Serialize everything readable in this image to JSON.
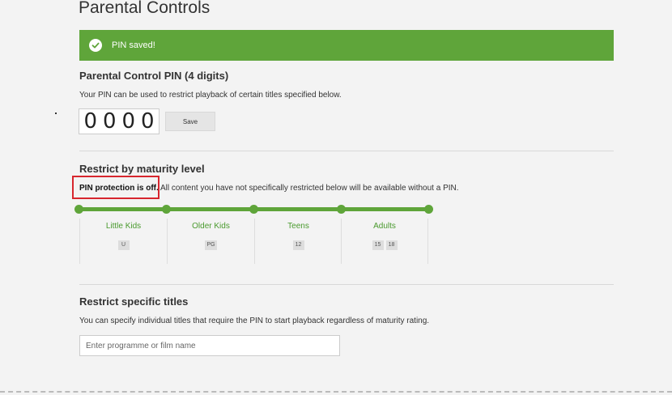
{
  "page": {
    "title": "Parental Controls"
  },
  "banner": {
    "message": "PIN saved!",
    "color": "#5fa53a"
  },
  "pin": {
    "heading": "Parental Control PIN (4 digits)",
    "description": "Your PIN can be used to restrict playback of certain titles specified below.",
    "digits": [
      "0",
      "0",
      "0",
      "0"
    ],
    "save_label": "Save"
  },
  "maturity": {
    "heading": "Restrict by maturity level",
    "status_bold": "PIN protection is off.",
    "status_rest": " All content you have not specifically restricted below will be available without a PIN.",
    "highlight_color": "#d7262e",
    "levels": [
      {
        "name": "Little Kids",
        "ratings": [
          "U"
        ]
      },
      {
        "name": "Older Kids",
        "ratings": [
          "PG"
        ]
      },
      {
        "name": "Teens",
        "ratings": [
          "12"
        ]
      },
      {
        "name": "Adults",
        "ratings": [
          "15",
          "18"
        ]
      }
    ]
  },
  "titles": {
    "heading": "Restrict specific titles",
    "description": "You can specify individual titles that require the PIN to start playback regardless of maturity rating.",
    "search_placeholder": "Enter programme or film name"
  }
}
